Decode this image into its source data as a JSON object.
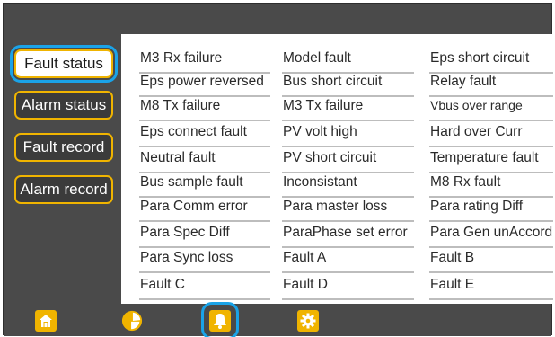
{
  "sidebar": {
    "items": [
      {
        "label": "Fault status",
        "active": true
      },
      {
        "label": "Alarm status",
        "active": false
      },
      {
        "label": "Fault record",
        "active": false
      },
      {
        "label": "Alarm record",
        "active": false
      }
    ]
  },
  "faults": {
    "rows": [
      [
        "M3 Rx failure",
        "Model fault",
        "Eps short circuit"
      ],
      [
        "Eps power reversed",
        "Bus short circuit",
        "Relay fault"
      ],
      [
        "M8 Tx failure",
        "M3 Tx failure",
        "Vbus over range"
      ],
      [
        "Eps connect fault",
        "PV volt high",
        "Hard over Curr"
      ],
      [
        "Neutral fault",
        "PV short circuit",
        "Temperature fault"
      ],
      [
        "Bus sample fault",
        "Inconsistant",
        "M8 Rx fault"
      ],
      [
        "Para Comm error",
        "Para master loss",
        "Para rating Diff"
      ],
      [
        "Para Spec Diff",
        "ParaPhase set error",
        "Para Gen unAccord"
      ],
      [
        "Para Sync loss",
        "Fault A",
        "Fault B"
      ],
      [
        "Fault C",
        "Fault D",
        "Fault E"
      ]
    ]
  },
  "bottom_nav": {
    "items": [
      {
        "icon": "home-icon",
        "active": false
      },
      {
        "icon": "pie-chart-icon",
        "active": false
      },
      {
        "icon": "bell-icon",
        "active": true
      },
      {
        "icon": "gear-icon",
        "active": false
      }
    ]
  },
  "colors": {
    "background": "#4a4a4a",
    "accent": "#f0b400",
    "selection": "#1aa3e8",
    "panel": "#ffffff"
  }
}
